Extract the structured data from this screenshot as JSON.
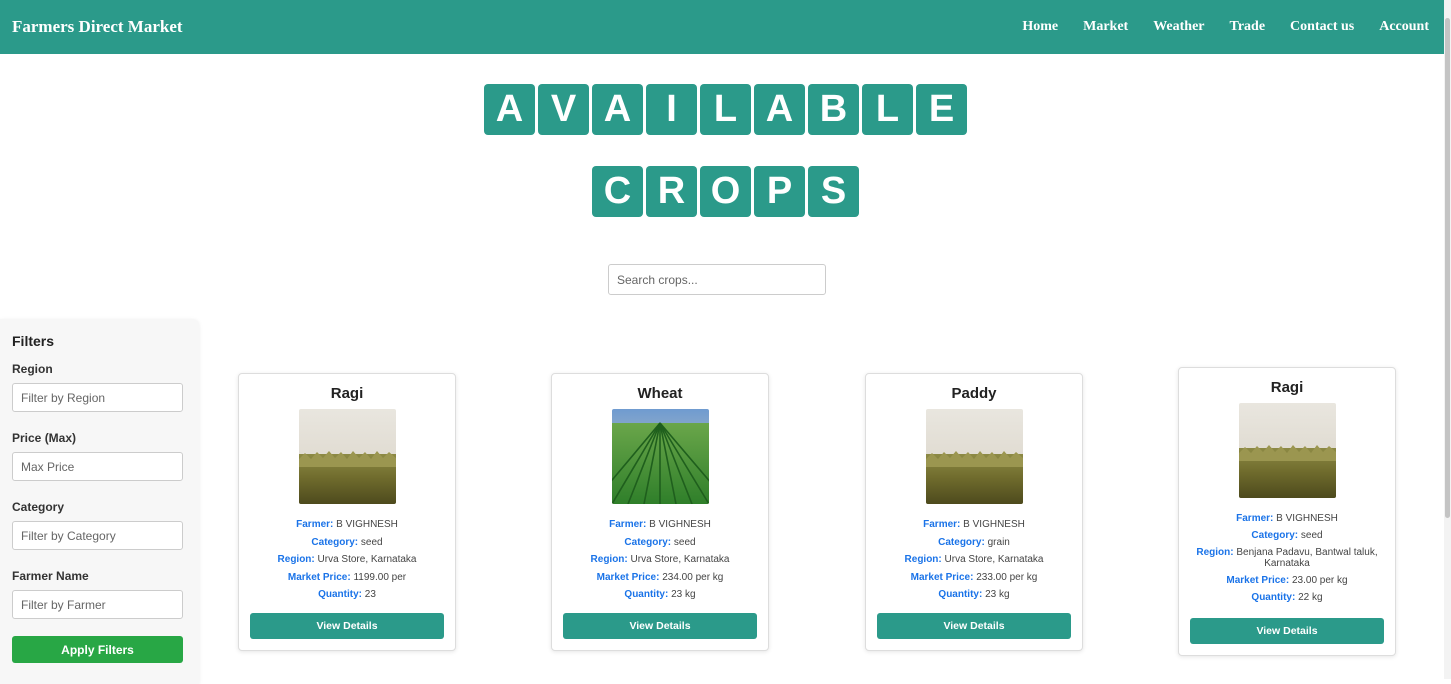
{
  "nav": {
    "brand": "Farmers Direct Market",
    "links": [
      "Home",
      "Market",
      "Weather",
      "Trade",
      "Contact us",
      "Account"
    ]
  },
  "title": {
    "row1": [
      "A",
      "V",
      "A",
      "I",
      "L",
      "A",
      "B",
      "L",
      "E"
    ],
    "row2": [
      "C",
      "R",
      "O",
      "P",
      "S"
    ]
  },
  "search": {
    "placeholder": "Search crops..."
  },
  "filters": {
    "title": "Filters",
    "region_label": "Region",
    "region_placeholder": "Filter by Region",
    "price_label": "Price (Max)",
    "price_placeholder": "Max Price",
    "category_label": "Category",
    "category_placeholder": "Filter by Category",
    "farmer_label": "Farmer Name",
    "farmer_placeholder": "Filter by Farmer",
    "apply_label": "Apply Filters"
  },
  "labels": {
    "farmer": "Farmer:",
    "category": "Category:",
    "region": "Region:",
    "price": "Market Price:",
    "quantity": "Quantity:"
  },
  "cards": [
    {
      "name": "Ragi",
      "image": "wheat-field-closeup",
      "farmer": "B VIGHNESH",
      "category": "seed",
      "region": "Urva Store, Karnataka",
      "price": "1199.00 per",
      "quantity": "23",
      "button": "View Details"
    },
    {
      "name": "Wheat",
      "image": "green-crop-rows",
      "farmer": "B VIGHNESH",
      "category": "seed",
      "region": "Urva Store, Karnataka",
      "price": "234.00 per kg",
      "quantity": "23 kg",
      "button": "View Details"
    },
    {
      "name": "Paddy",
      "image": "wheat-field-closeup",
      "farmer": "B VIGHNESH",
      "category": "grain",
      "region": "Urva Store, Karnataka",
      "price": "233.00 per kg",
      "quantity": "23 kg",
      "button": "View Details"
    },
    {
      "name": "Ragi",
      "image": "wheat-field-closeup",
      "farmer": "B VIGHNESH",
      "category": "seed",
      "region": "Benjana Padavu, Bantwal taluk, Karnataka",
      "price": "23.00 per kg",
      "quantity": "22 kg",
      "button": "View Details"
    }
  ],
  "colors": {
    "primary": "#2b9a8a",
    "apply": "#28a745",
    "info_key": "#1a73e8"
  }
}
